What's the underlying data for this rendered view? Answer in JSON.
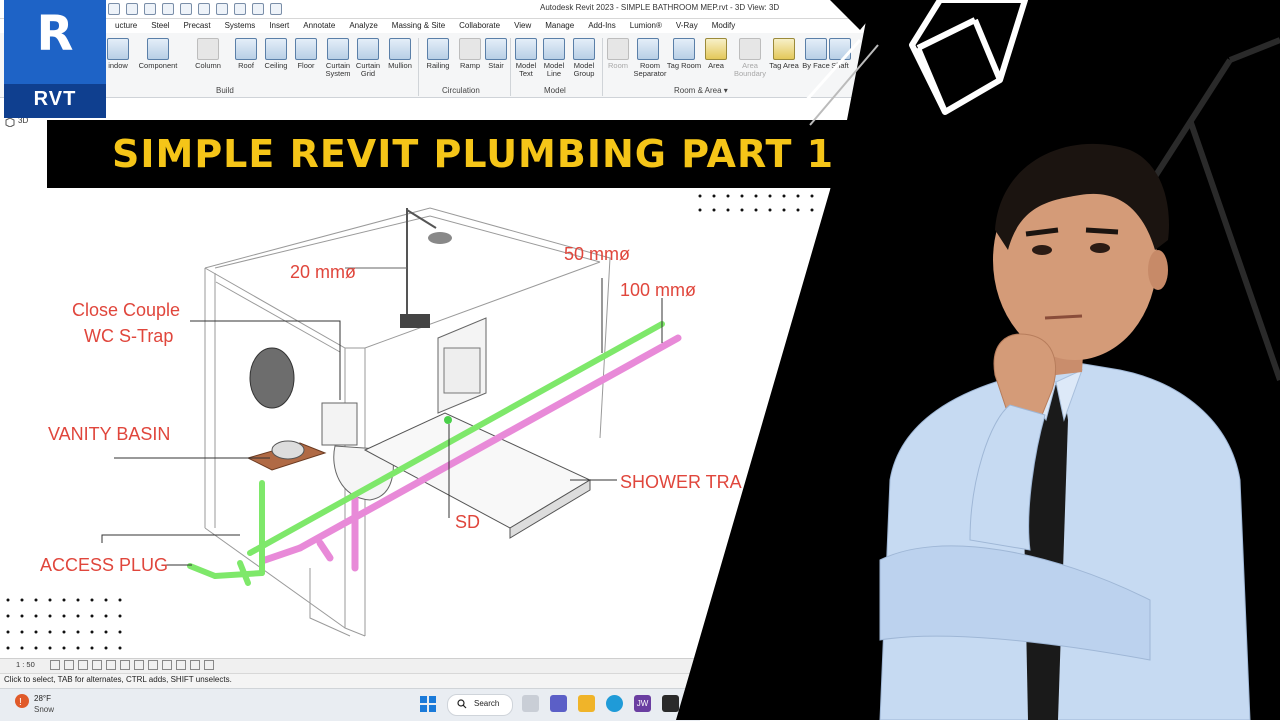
{
  "window": {
    "title": "Autodesk Revit 2023 - SIMPLE BATHROOM MEP.rvt - 3D View: 3D"
  },
  "menu_tabs": [
    "ucture",
    "Steel",
    "Precast",
    "Systems",
    "Insert",
    "Annotate",
    "Analyze",
    "Massing & Site",
    "Collaborate",
    "View",
    "Manage",
    "Add-Ins",
    "Lumion®",
    "V-Ray",
    "Modify"
  ],
  "ribbon": {
    "build": {
      "label": "Build",
      "tools": [
        "indow",
        "Component",
        "Column",
        "Roof",
        "Ceiling",
        "Floor",
        "Curtain System",
        "Curtain Grid",
        "Mullion"
      ]
    },
    "circulation": {
      "label": "Circulation",
      "tools": [
        "Railing",
        "Ramp",
        "Stair"
      ]
    },
    "model": {
      "label": "Model",
      "tools": [
        "Model Text",
        "Model Line",
        "Model Group"
      ]
    },
    "room_area": {
      "label": "Room & Area ▾",
      "tools": [
        "Room",
        "Room Separator",
        "Tag Room",
        "Area",
        "Area Boundary",
        "Tag Area",
        "By Face",
        "Shaft"
      ]
    }
  },
  "view": {
    "name": "3D"
  },
  "logo": {
    "letter": "R",
    "text": "RVT"
  },
  "banner": {
    "text": "SIMPLE REVIT PLUMBING PART 1"
  },
  "annotations": {
    "pipe_20": "20 mmø",
    "pipe_50": "50 mmø",
    "pipe_100": "100 mmø",
    "wc": "Close Couple",
    "wc2": "WC S-Trap",
    "vanity": "VANITY BASIN",
    "shower": "SHOWER TRA",
    "sd": "SD",
    "access": "ACCESS PLUG"
  },
  "status": {
    "scale": "1 : 50",
    "hint": "Click to select, TAB for alternates, CTRL adds, SHIFT unselects."
  },
  "taskbar": {
    "temp": "28°F",
    "condition": "Snow",
    "search": "Search",
    "jw": "JW"
  },
  "colors": {
    "banner_text": "#f5c518",
    "annotation_red": "#e0463c",
    "pipe_green": "#7ee86a",
    "pipe_pink": "#e88ad8",
    "revit_blue": "#1e63c6"
  }
}
